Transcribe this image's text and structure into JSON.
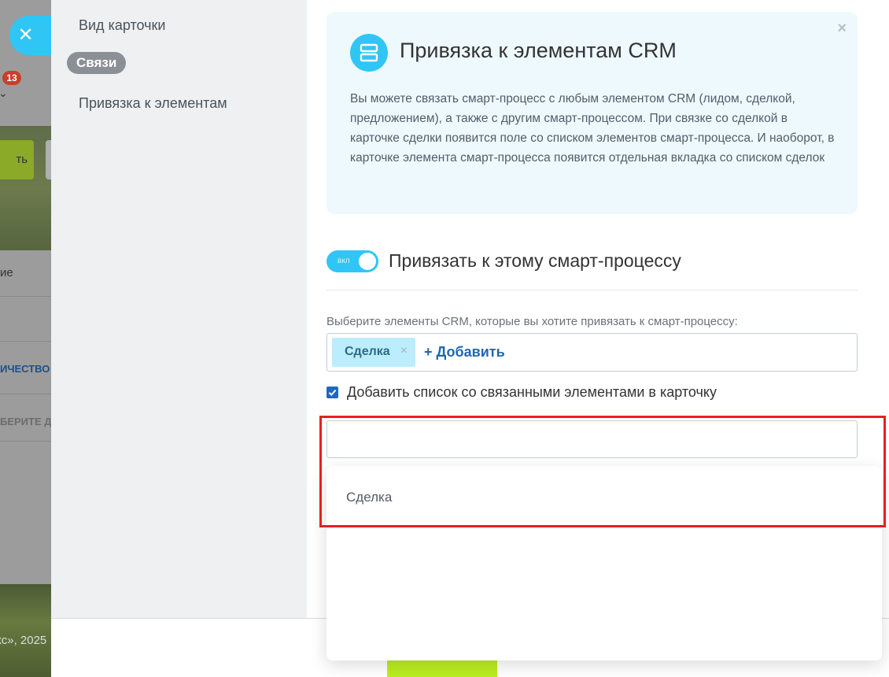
{
  "background": {
    "badge_count": "13",
    "green_button_text": "ть",
    "row1_text": "ие",
    "row2_text": "ИЧЕСТВО",
    "row3_text": "БЕРИТЕ Д",
    "footer_text": "кс», 2025"
  },
  "nav": {
    "items": [
      {
        "label": "Вид карточки"
      },
      {
        "label": "Связи"
      },
      {
        "label": "Привязка к элементам"
      }
    ]
  },
  "info": {
    "title": "Привязка к элементам CRM",
    "close_symbol": "×",
    "text": "Вы можете связать смарт-процесс с любым элементом CRM (лидом, сделкой, предложением), а также с другим смарт-процессом. При связке со сделкой в карточке сделки появится поле со списком элементов смарт-процесса. И наоборот, в карточке элемента смарт-процесса появится отдельная вкладка со списком сделок"
  },
  "binding": {
    "toggle_state": "вкл",
    "title": "Привязать к этому смарт-процессу",
    "field_caption": "Выберите элементы CRM, которые вы хотите привязать к смарт-процессу:",
    "selected_tags": [
      {
        "label": "Сделка"
      }
    ],
    "tag_remove_symbol": "×",
    "add_label": "+ Добавить",
    "checkbox_checked": true,
    "checkbox_label": "Добавить список со связанными элементами в карточку",
    "search_value": ""
  },
  "dropdown": {
    "options": [
      {
        "label": "Сделка"
      }
    ]
  },
  "colors": {
    "accent": "#2fc6f6",
    "tag_bg": "#bcedfc",
    "link": "#2067b0",
    "save_button": "#bbed21",
    "highlight": "#ec1c24"
  }
}
